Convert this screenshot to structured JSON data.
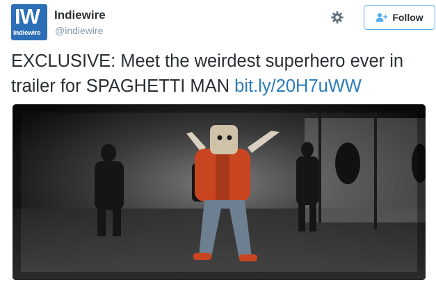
{
  "account": {
    "avatar_text": "IW",
    "avatar_subtext": "Indiewire",
    "display_name": "Indiewire",
    "handle": "@indiewire"
  },
  "actions": {
    "settings_icon": "gear-icon",
    "follow_icon": "add-person-icon",
    "follow_label": "Follow"
  },
  "tweet": {
    "text": "EXCLUSIVE: Meet the weirdest superhero ever in trailer for SPAGHETTI MAN",
    "link": "bit.ly/20H7uWW"
  },
  "colors": {
    "brand_blue": "#2d6fb6",
    "accent": "#55acee",
    "link": "#2b7bb9",
    "text": "#292f33",
    "muted": "#8899a6"
  }
}
